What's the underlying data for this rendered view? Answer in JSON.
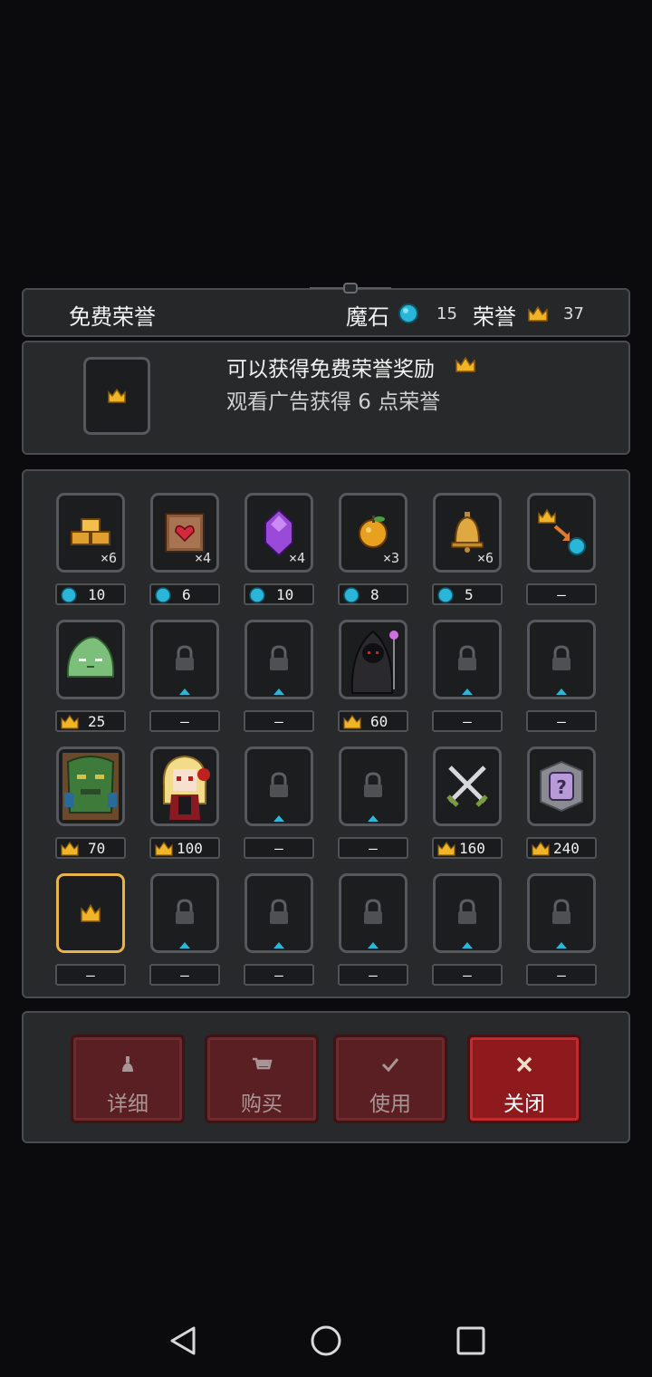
{
  "header": {
    "title": "免费荣誉",
    "magic_stone_label": "魔石",
    "magic_stone_value": "15",
    "honor_label": "荣誉",
    "honor_value": "37"
  },
  "info": {
    "line1": "可以获得免费荣誉奖励",
    "line2": "观看广告获得 6 点荣誉"
  },
  "grid": {
    "row1": [
      {
        "icon": "gold-bars-icon",
        "qty": "×6",
        "price": "10",
        "currency": "stone"
      },
      {
        "icon": "heart-scroll-icon",
        "qty": "×4",
        "price": "6",
        "currency": "stone"
      },
      {
        "icon": "purple-gem-icon",
        "qty": "×4",
        "price": "10",
        "currency": "stone"
      },
      {
        "icon": "golden-apple-icon",
        "qty": "×3",
        "price": "8",
        "currency": "stone"
      },
      {
        "icon": "bell-icon",
        "qty": "×6",
        "price": "5",
        "currency": "stone"
      },
      {
        "icon": "crown-to-stone-exchange-icon",
        "qty": "",
        "price": "—",
        "currency": "none"
      }
    ],
    "row2": [
      {
        "icon": "green-slime-icon",
        "price": "25",
        "currency": "honor"
      },
      {
        "icon": "lock-icon",
        "price": "—",
        "currency": "none"
      },
      {
        "icon": "lock-icon",
        "price": "—",
        "currency": "none"
      },
      {
        "icon": "hooded-reaper-icon",
        "price": "60",
        "currency": "honor"
      },
      {
        "icon": "lock-icon",
        "price": "—",
        "currency": "none"
      },
      {
        "icon": "lock-icon",
        "price": "—",
        "currency": "none"
      }
    ],
    "row3": [
      {
        "icon": "tree-golem-icon",
        "price": "70",
        "currency": "honor"
      },
      {
        "icon": "blonde-vampire-girl-icon",
        "price": "100",
        "currency": "honor"
      },
      {
        "icon": "lock-icon",
        "price": "—",
        "currency": "none"
      },
      {
        "icon": "lock-icon",
        "price": "—",
        "currency": "none"
      },
      {
        "icon": "crossed-swords-icon",
        "price": "160",
        "currency": "honor"
      },
      {
        "icon": "mystery-box-icon",
        "price": "240",
        "currency": "honor"
      }
    ],
    "row4": [
      {
        "icon": "crown-icon",
        "price": "—",
        "currency": "none",
        "selected": true
      },
      {
        "icon": "lock-icon",
        "price": "—",
        "currency": "none"
      },
      {
        "icon": "lock-icon",
        "price": "—",
        "currency": "none"
      },
      {
        "icon": "lock-icon",
        "price": "—",
        "currency": "none"
      },
      {
        "icon": "lock-icon",
        "price": "—",
        "currency": "none"
      },
      {
        "icon": "lock-icon",
        "price": "—",
        "currency": "none"
      }
    ]
  },
  "buttons": {
    "details": "详细",
    "buy": "购买",
    "use": "使用",
    "close": "关闭"
  },
  "colors": {
    "stone": "#2ab6d8",
    "crown": "#f0b429",
    "selected_border": "#e8b34a",
    "close_button": "#8f1a1e"
  }
}
